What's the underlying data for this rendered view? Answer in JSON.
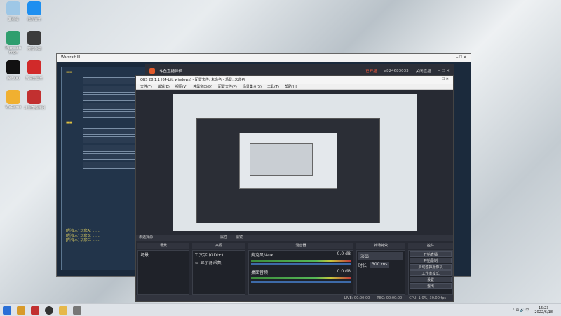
{
  "desktop": {
    "icons": [
      {
        "label": "回收站",
        "color": "#9ec7e6"
      },
      {
        "label": "酷狗音乐",
        "color": "#1e8ff0"
      },
      {
        "label": "Microsoft Edge",
        "color": "#2f9e6e"
      },
      {
        "label": "魔兽争霸",
        "color": "#3b3b3b"
      },
      {
        "label": "腾讯QQ",
        "color": "#111111"
      },
      {
        "label": "网易云音乐",
        "color": "#d12a2a"
      },
      {
        "label": "WeGame",
        "color": "#f0b030"
      },
      {
        "label": "斗鱼直播伴侣",
        "color": "#c23030"
      }
    ]
  },
  "bg_window": {
    "title": "Warcraft III",
    "chat_lines": [
      "[所有人] 玩家A：……",
      "[所有人] 玩家B：……",
      "[所有人] 玩家C：……"
    ]
  },
  "douyu": {
    "title": "斗鱼直播伴侣",
    "status": "已开播",
    "room": "a824683033",
    "action": "关闭直播"
  },
  "obs": {
    "title": "OBS 28.1.1 (64-bit, windows) - 配置文件: 未命名 - 场景: 未命名",
    "menu": [
      "文件(F)",
      "编辑(E)",
      "视图(V)",
      "停靠窗口(D)",
      "配置文件(P)",
      "场景集合(S)",
      "工具(T)",
      "帮助(H)"
    ],
    "toolbar": {
      "no_source": "未选择源",
      "properties": "属性",
      "filters": "滤镜"
    },
    "docks": {
      "scenes": "场景",
      "sources": "来源",
      "mixer": "混音器",
      "transitions": "转场特效",
      "controls": "控件"
    },
    "scene_items": [
      "场景"
    ],
    "source_items": [
      "文字 (GDI+)",
      "显示器采集"
    ],
    "mixer_channels": [
      {
        "name": "麦克风/Aux",
        "db": "0.0 dB"
      },
      {
        "name": "桌面音频",
        "db": "0.0 dB"
      }
    ],
    "transition": {
      "type": "淡出",
      "duration_label": "时长",
      "duration": "300 ms"
    },
    "controls": [
      "开始直播",
      "开始录制",
      "启动虚拟摄像机",
      "工作室模式",
      "设置",
      "退出"
    ],
    "status": {
      "live": "LIVE: 00:00:00",
      "rec": "REC: 00:00:00",
      "cpu": "CPU: 1.0%, 30.00 fps"
    }
  },
  "taskbar": {
    "time": "15:23",
    "date": "2022/6/18"
  }
}
